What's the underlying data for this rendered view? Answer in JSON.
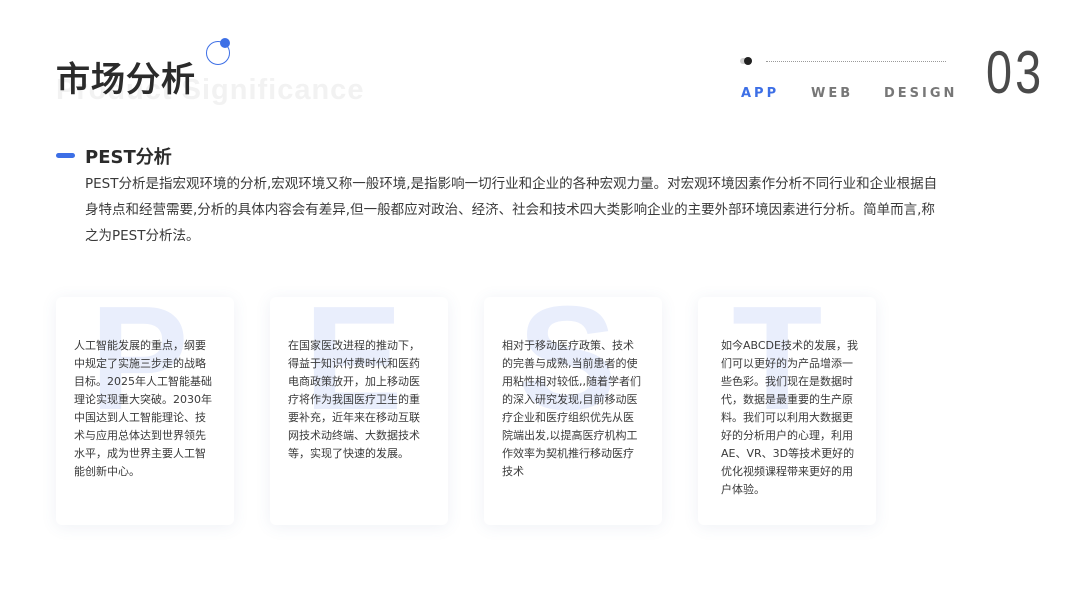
{
  "header": {
    "title": "市场分析",
    "subtitle_ghost": "Product Significance",
    "nav": [
      "APP",
      "WEB",
      "DESIGN"
    ],
    "page_number": "03",
    "accent_color": "#3d6fe6"
  },
  "section": {
    "title": "PEST分析",
    "description": "PEST分析是指宏观环境的分析,宏观环境又称一般环境,是指影响一切行业和企业的各种宏观力量。对宏观环境因素作分析不同行业和企业根据自身特点和经营需要,分析的具体内容会有差异,但一般都应对政治、经济、社会和技术四大类影响企业的主要外部环境因素进行分析。简单而言,称之为PEST分析法。"
  },
  "cards": [
    {
      "letter": "P",
      "text": "人工智能发展的重点，纲要中规定了实施三步走的战略目标。2025年人工智能基础理论实现重大突破。2030年中国达到人工智能理论、技术与应用总体达到世界领先水平，成为世界主要人工智能创新中心。"
    },
    {
      "letter": "E",
      "text": "在国家医改进程的推动下，得益于知识付费时代和医药电商政策放开，加上移动医疗将作为我国医疗卫生的重要补充，近年来在移动互联网技术动终端、大数据技术等，实现了快速的发展。"
    },
    {
      "letter": "S",
      "text": "相对于移动医疗政策、技术的完善与成熟,当前患者的使用粘性相对较低,,随着学者们的深入研究发现,目前移动医疗企业和医疗组织优先从医院端出发,以提高医疗机构工作效率为契机推行移动医疗技术"
    },
    {
      "letter": "T",
      "text": "如今ABCDE技术的发展，我们可以更好的为产品增添一些色彩。我们现在是数据时代，数据是最重要的生产原料。我们可以利用大数据更好的分析用户的心理，利用AE、VR、3D等技术更好的优化视频课程带来更好的用户体验。"
    }
  ]
}
